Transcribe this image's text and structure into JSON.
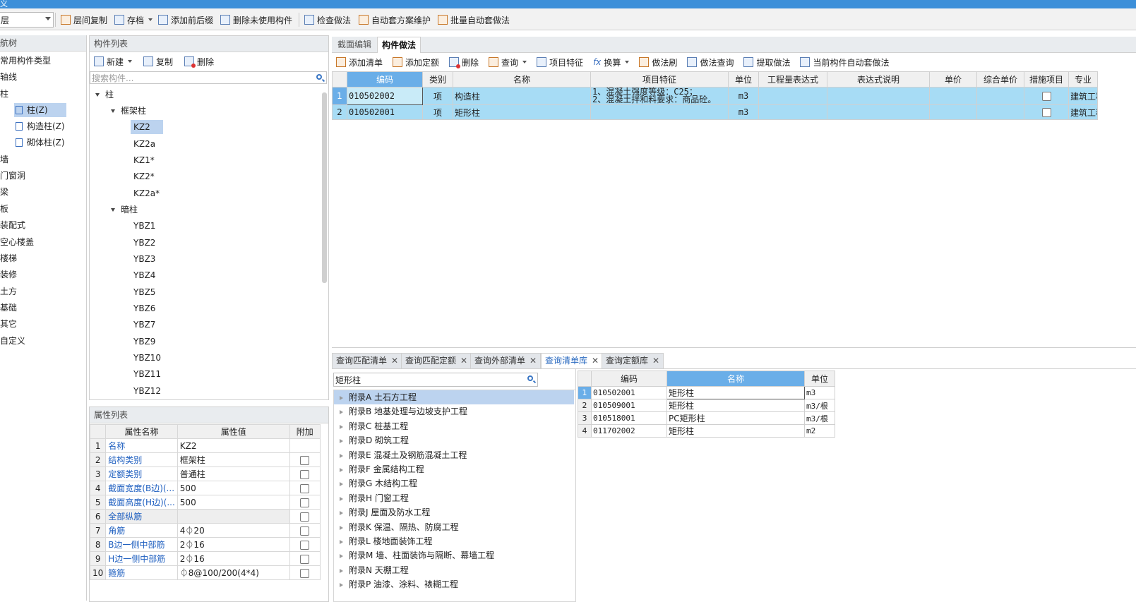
{
  "app": {
    "title_fragment": "义"
  },
  "toolbar": {
    "combo_value": "层",
    "items": [
      "层间复制",
      "存档",
      "添加前后缀",
      "删除未使用构件",
      "检查做法",
      "自动套方案维护",
      "批量自动套做法"
    ]
  },
  "nav": {
    "title": "航树",
    "items": [
      "常用构件类型",
      "轴线",
      "柱",
      "墙",
      "门窗洞",
      "梁",
      "板",
      "装配式",
      "空心楼盖",
      "楼梯",
      "装修",
      "土方",
      "基础",
      "其它",
      "自定义"
    ],
    "sub_items": [
      "柱(Z)",
      "构造柱(Z)",
      "砌体柱(Z)"
    ]
  },
  "component_list": {
    "title": "构件列表",
    "toolbar": [
      "新建",
      "复制",
      "删除"
    ],
    "search_placeholder": "搜索构件...",
    "tree": {
      "root": "柱",
      "groups": [
        {
          "label": "框架柱",
          "children": [
            "KZ2",
            "KZ2a",
            "KZ1*",
            "KZ2*",
            "KZ2a*"
          ]
        },
        {
          "label": "暗柱",
          "children": [
            "YBZ1",
            "YBZ2",
            "YBZ3",
            "YBZ4",
            "YBZ5",
            "YBZ6",
            "YBZ7",
            "YBZ9",
            "YBZ10",
            "YBZ11",
            "YBZ12"
          ]
        }
      ]
    }
  },
  "attributes": {
    "title": "属性列表",
    "headers": [
      "属性名称",
      "属性值",
      "附加"
    ],
    "rows": [
      {
        "idx": "1",
        "name": "名称",
        "value": "KZ2"
      },
      {
        "idx": "2",
        "name": "结构类别",
        "value": "框架柱"
      },
      {
        "idx": "3",
        "name": "定额类别",
        "value": "普通柱"
      },
      {
        "idx": "4",
        "name": "截面宽度(B边)(...",
        "value": "500"
      },
      {
        "idx": "5",
        "name": "截面高度(H边)(...",
        "value": "500"
      },
      {
        "idx": "6",
        "name": "全部纵筋",
        "value": ""
      },
      {
        "idx": "7",
        "name": "角筋",
        "value": "4⏀20"
      },
      {
        "idx": "8",
        "name": "B边一侧中部筋",
        "value": "2⏀16"
      },
      {
        "idx": "9",
        "name": "H边一侧中部筋",
        "value": "2⏀16"
      },
      {
        "idx": "10",
        "name": "箍筋",
        "value": "⏀8@100/200(4*4)"
      }
    ]
  },
  "right_tabs": [
    "截面编辑",
    "构件做法"
  ],
  "method_toolbar": [
    "添加清单",
    "添加定额",
    "删除",
    "查询",
    "项目特征",
    "换算",
    "做法刷",
    "做法查询",
    "提取做法",
    "当前构件自动套做法"
  ],
  "method_grid": {
    "headers": [
      "编码",
      "类别",
      "名称",
      "项目特征",
      "单位",
      "工程量表达式",
      "表达式说明",
      "单价",
      "综合单价",
      "措施项目",
      "专业"
    ],
    "rows": [
      {
        "idx": "1",
        "code": "010502002",
        "type": "项",
        "name": "构造柱",
        "feature1": "1、混凝土强度等级：C25；",
        "feature2": "2、混凝土拌和料要求：商品砼。",
        "unit": "m3",
        "major": "建筑工程"
      },
      {
        "idx": "2",
        "code": "010502001",
        "type": "项",
        "name": "矩形柱",
        "feature1": "",
        "feature2": "",
        "unit": "m3",
        "major": "建筑工程"
      }
    ]
  },
  "query_tabs": [
    "查询匹配清单",
    "查询匹配定额",
    "查询外部清单",
    "查询清单库",
    "查询定额库"
  ],
  "query": {
    "search_value": "矩形柱",
    "appendix": [
      "附录A 土石方工程",
      "附录B 地基处理与边坡支护工程",
      "附录C 桩基工程",
      "附录D 砌筑工程",
      "附录E 混凝土及钢筋混凝土工程",
      "附录F 金属结构工程",
      "附录G 木结构工程",
      "附录H 门窗工程",
      "附录J 屋面及防水工程",
      "附录K 保温、隔热、防腐工程",
      "附录L 楼地面装饰工程",
      "附录M 墙、柱面装饰与隔断、幕墙工程",
      "附录N 天棚工程",
      "附录P 油漆、涂料、裱糊工程"
    ],
    "result_headers": [
      "编码",
      "名称",
      "单位"
    ],
    "results": [
      {
        "idx": "1",
        "code": "010502001",
        "name": "矩形柱",
        "unit": "m3"
      },
      {
        "idx": "2",
        "code": "010509001",
        "name": "矩形柱",
        "unit": "m3/根"
      },
      {
        "idx": "3",
        "code": "010518001",
        "name": "PC矩形柱",
        "unit": "m3/根"
      },
      {
        "idx": "4",
        "code": "011702002",
        "name": "矩形柱",
        "unit": "m2"
      }
    ]
  },
  "colors": {
    "accent": "#3c8fd9",
    "selection": "#bcd3ef",
    "grid_highlight": "#a7dcf5",
    "header_highlight": "#6aaee8",
    "link_blue": "#2060c0"
  }
}
